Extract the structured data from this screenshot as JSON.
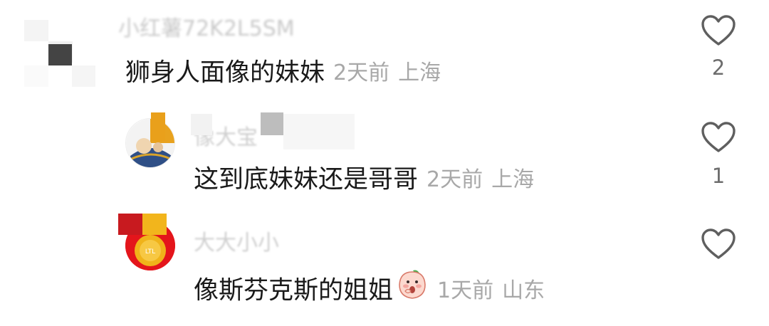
{
  "comments": [
    {
      "username": "小红薯72K2L5SM",
      "text": "狮身人面像的妹妹",
      "time": "2天前",
      "location": "上海",
      "likes": "2"
    },
    {
      "username": "像大宝",
      "text": "这到底妹妹还是哥哥",
      "time": "2天前",
      "location": "上海",
      "likes": "1",
      "avatar_badge": ""
    },
    {
      "username": "大大小小",
      "text": "像斯芬克斯的姐姐",
      "time": "1天前",
      "location": "山东",
      "likes": "",
      "avatar_badge": "LTL"
    }
  ],
  "icons": {
    "like": "heart-outline-icon",
    "emoji": "peach-face-emoji-icon"
  },
  "colors": {
    "text_primary": "#1a1a1a",
    "text_meta": "#a8a8a8",
    "like_count": "#6d6d6d",
    "icon_stroke": "#5f5f5f"
  }
}
